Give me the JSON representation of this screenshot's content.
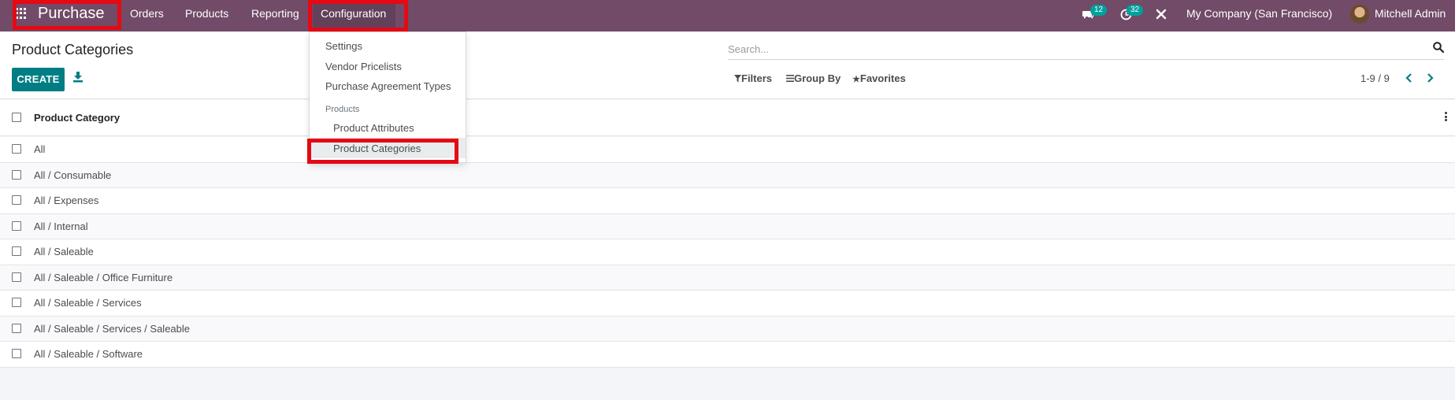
{
  "navbar": {
    "brand": "Purchase",
    "menus": [
      "Orders",
      "Products",
      "Reporting",
      "Configuration"
    ],
    "active_menu": "Configuration",
    "messages_count": "12",
    "activities_count": "32",
    "company": "My Company (San Francisco)",
    "user": "Mitchell Admin",
    "icons": [
      "apps-icon",
      "chat-icon",
      "clock-icon",
      "debug-tools-icon",
      "avatar"
    ]
  },
  "control_panel": {
    "title": "Product Categories",
    "create_label": "CREATE",
    "search_placeholder": "Search...",
    "filters_label": "Filters",
    "group_by_label": "Group By",
    "favorites_label": "Favorites",
    "pager": "1-9 / 9"
  },
  "list": {
    "column_header": "Product Category",
    "rows": [
      "All",
      "All / Consumable",
      "All / Expenses",
      "All / Internal",
      "All / Saleable",
      "All / Saleable / Office Furniture",
      "All / Saleable / Services",
      "All / Saleable / Services / Saleable",
      "All / Saleable / Software"
    ]
  },
  "dropdown": {
    "items": [
      "Settings",
      "Vendor Pricelists",
      "Purchase Agreement Types"
    ],
    "section_label": "Products",
    "sub_items": [
      "Product Attributes",
      "Product Categories"
    ],
    "highlighted_item": "Product Categories"
  },
  "colors": {
    "navbar": "#714b67",
    "primary": "#017e84",
    "badge": "#00a09d",
    "highlight": "#e50914"
  }
}
